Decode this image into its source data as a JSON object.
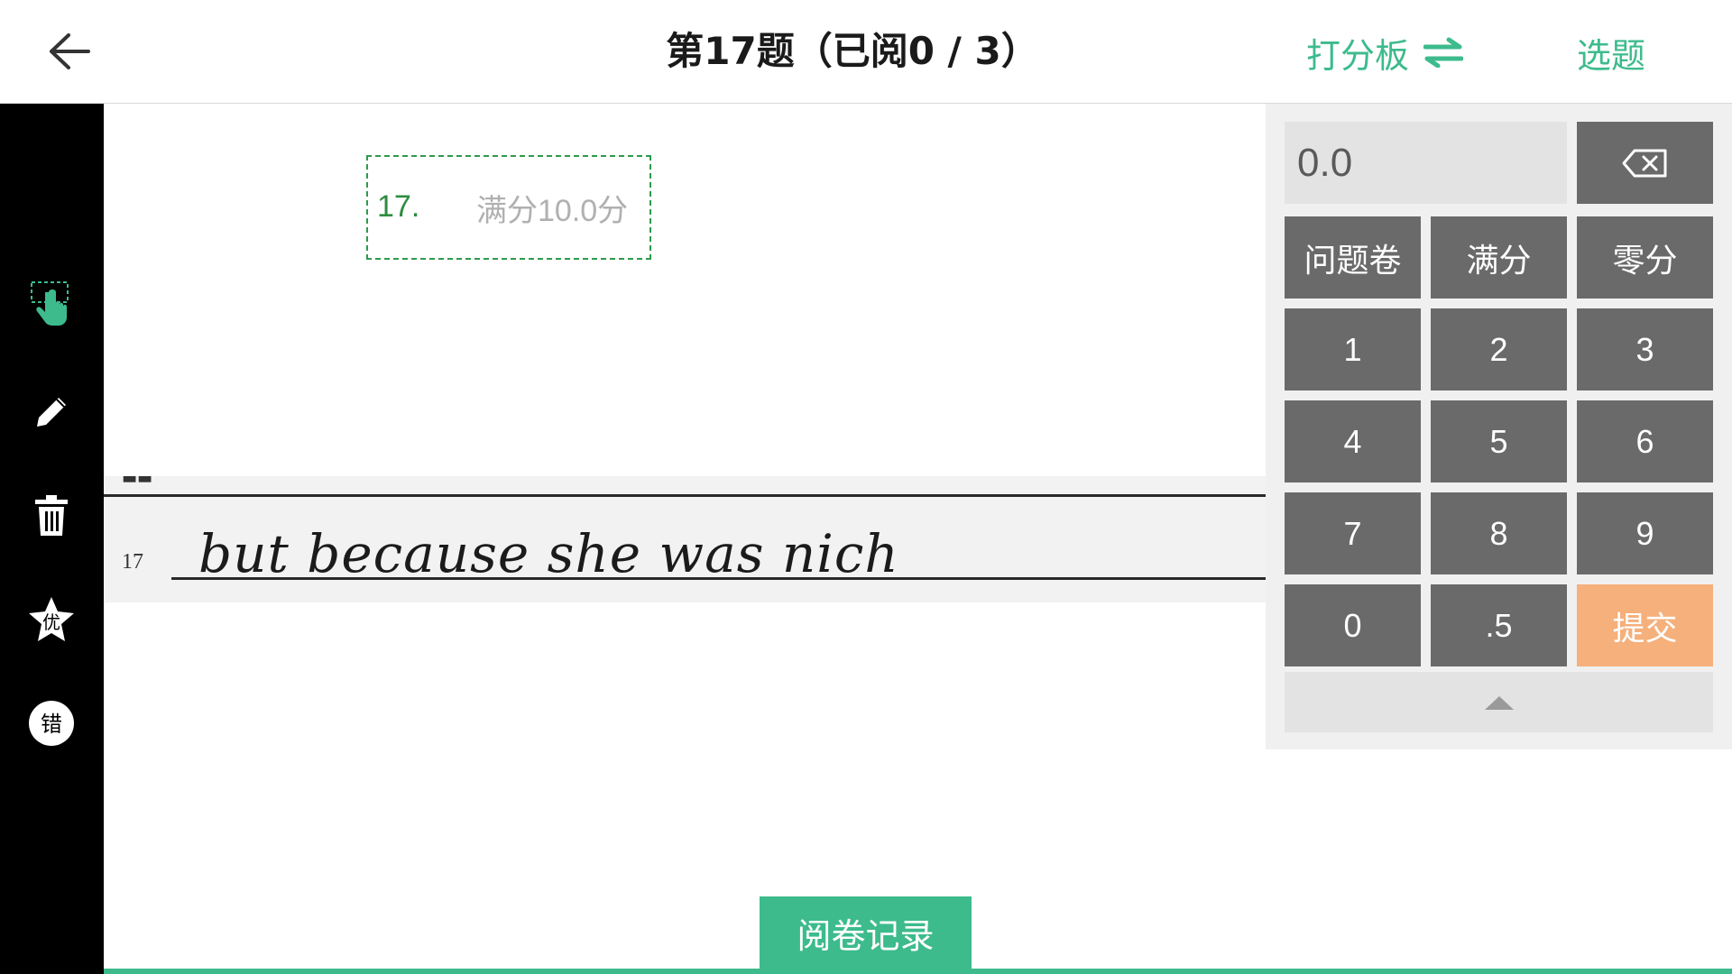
{
  "header": {
    "title": "第17题（已阅0 / 3）",
    "scoreboard_label": "打分板",
    "select_label": "选题"
  },
  "toolbar": {
    "tools": [
      {
        "name": "select-tool",
        "icon": "hand-pointer-icon"
      },
      {
        "name": "pen-tool",
        "icon": "pencil-icon"
      },
      {
        "name": "delete-tool",
        "icon": "trash-icon"
      },
      {
        "name": "excellent-tool",
        "icon": "star-icon",
        "label": "优"
      },
      {
        "name": "wrong-tool",
        "icon": "circle-icon",
        "label": "错"
      }
    ]
  },
  "paper": {
    "score_box": {
      "question_number": "17.",
      "full_score": "满分10.0分"
    },
    "answer": {
      "line_number": "17",
      "text": "but because she was nich"
    }
  },
  "keypad": {
    "display_value": "0.0",
    "backspace_icon": "backspace-icon",
    "row1": [
      "问题卷",
      "满分",
      "零分"
    ],
    "digits": [
      "1",
      "2",
      "3",
      "4",
      "5",
      "6",
      "7",
      "8",
      "9"
    ],
    "zero": "0",
    "half": ".5",
    "submit": "提交",
    "collapse_icon": "triangle-up-icon"
  },
  "footer": {
    "record_label": "阅卷记录"
  },
  "colors": {
    "accent": "#3dbb8d",
    "key": "#6a6a6a",
    "submit": "#f5b07c",
    "toolbar": "#000000"
  }
}
